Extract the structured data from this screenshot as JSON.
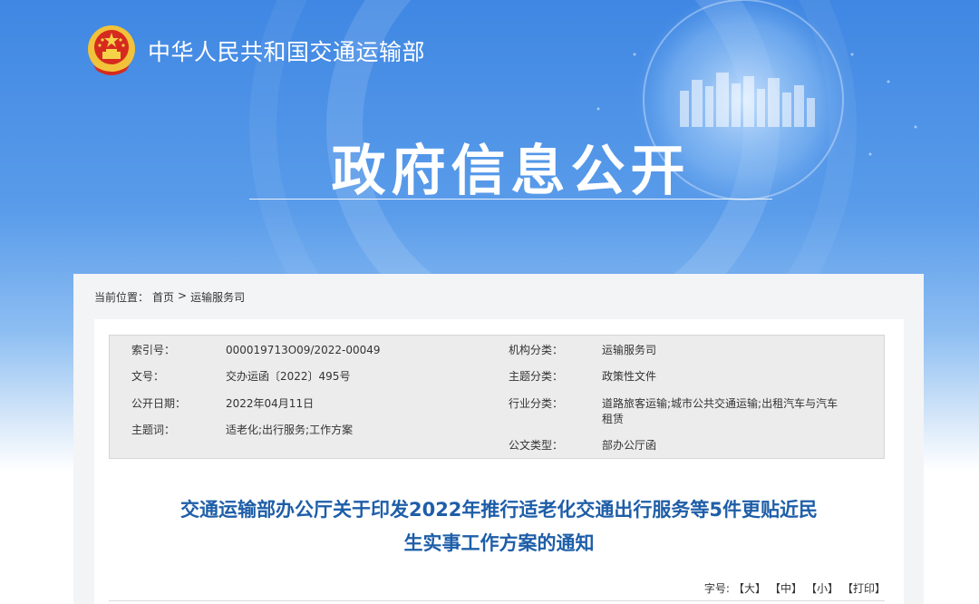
{
  "header": {
    "site_name": "中华人民共和国交通运输部",
    "banner_title": "政府信息公开",
    "emblem_icon": "national-emblem-icon"
  },
  "breadcrumb": {
    "prefix": "当前位置：",
    "home": "首页",
    "separator": ">",
    "current": "运输服务司"
  },
  "meta": {
    "index_label": "索引号：",
    "index_value": "000019713O09/2022-00049",
    "doc_no_label": "文号：",
    "doc_no_value": "交办运函〔2022〕495号",
    "date_label": "公开日期：",
    "date_value": "2022年04月11日",
    "keywords_label": "主题词：",
    "keywords_value": "适老化;出行服务;工作方案",
    "org_label": "机构分类：",
    "org_value": "运输服务司",
    "topic_label": "主题分类：",
    "topic_value": "政策性文件",
    "industry_label": "行业分类：",
    "industry_value_1": "道路旅客运输;城市公共交通运输;出租汽车与汽车",
    "industry_value_2": "租赁",
    "doctype_label": "公文类型：",
    "doctype_value": "部办公厅函"
  },
  "article": {
    "title_line1": "交通运输部办公厅关于印发2022年推行适老化交通出行服务等5件更贴近民",
    "title_line2": "生实事工作方案的通知"
  },
  "font_tools": {
    "label": "字号:",
    "large": "【大】",
    "medium": "【中】",
    "small": "【小】",
    "print": "【打印】"
  },
  "colors": {
    "banner_blue": "#3f87e3",
    "title_blue": "#1e5ea8",
    "panel_gray": "#f3f4f6"
  }
}
